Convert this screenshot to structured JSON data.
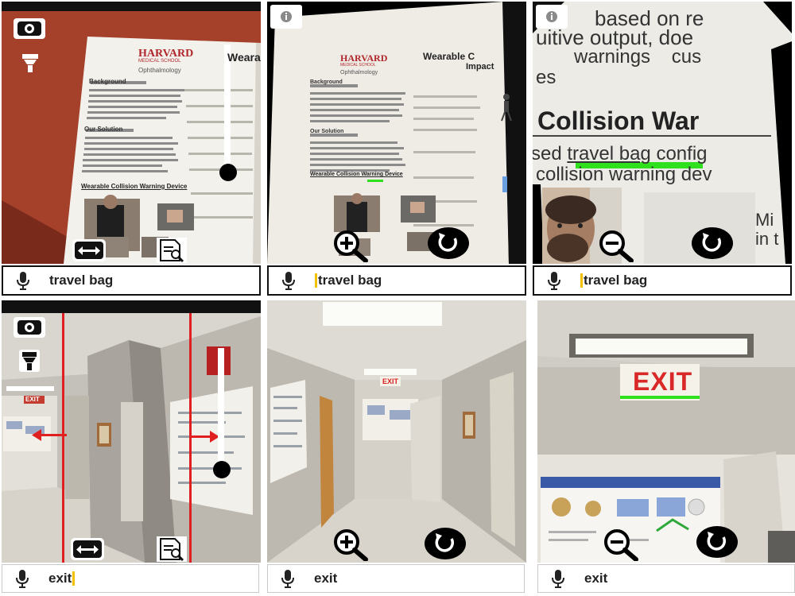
{
  "panels": [
    {
      "query": "travel bag",
      "caret": "none"
    },
    {
      "query": "travel bag",
      "caret": "before"
    },
    {
      "query": "travel bag",
      "caret": "before"
    },
    {
      "query": "exit",
      "caret": "after"
    },
    {
      "query": "exit",
      "caret": "none"
    },
    {
      "query": "exit",
      "caret": "none"
    }
  ],
  "poster": {
    "logo": "HARVARD",
    "logo_sub": "MEDICAL SCHOOL",
    "dept": "Ophthalmology",
    "title_fragment": "Wearab",
    "title_fragment_b": "Wearable C",
    "title_fragment_b2": "Impact",
    "sec_background": "Background",
    "sec_solution": "Our Solution",
    "sec_device": "Wearable Collision Warning Device"
  },
  "zoomed_text": {
    "line1": "based on re",
    "line2": "uitive output, doe",
    "line3": "warnings    cus",
    "line4": "es",
    "heading": "Collision War",
    "line5a": "sed ",
    "line5b": "travel bag",
    "line5c": " config",
    "line6": "collision warning dev",
    "side1": "Mi",
    "side2": "in t"
  },
  "signs": {
    "exit": "EXIT"
  },
  "colors": {
    "highlight": "#2fe01d",
    "red_line": "#e02020",
    "wall_red": "#a33a26",
    "caret": "#f2c200"
  },
  "icons": {
    "settings": "camera-settings-icon",
    "flashlight": "flashlight-icon",
    "slider": "zoom-slider",
    "pan": "pan-arrows-icon",
    "doc_search": "document-search-icon",
    "zoom_in": "zoom-in-icon",
    "zoom_out": "zoom-out-icon",
    "reset": "reset-icon",
    "info": "info-icon",
    "mic": "microphone-icon"
  }
}
